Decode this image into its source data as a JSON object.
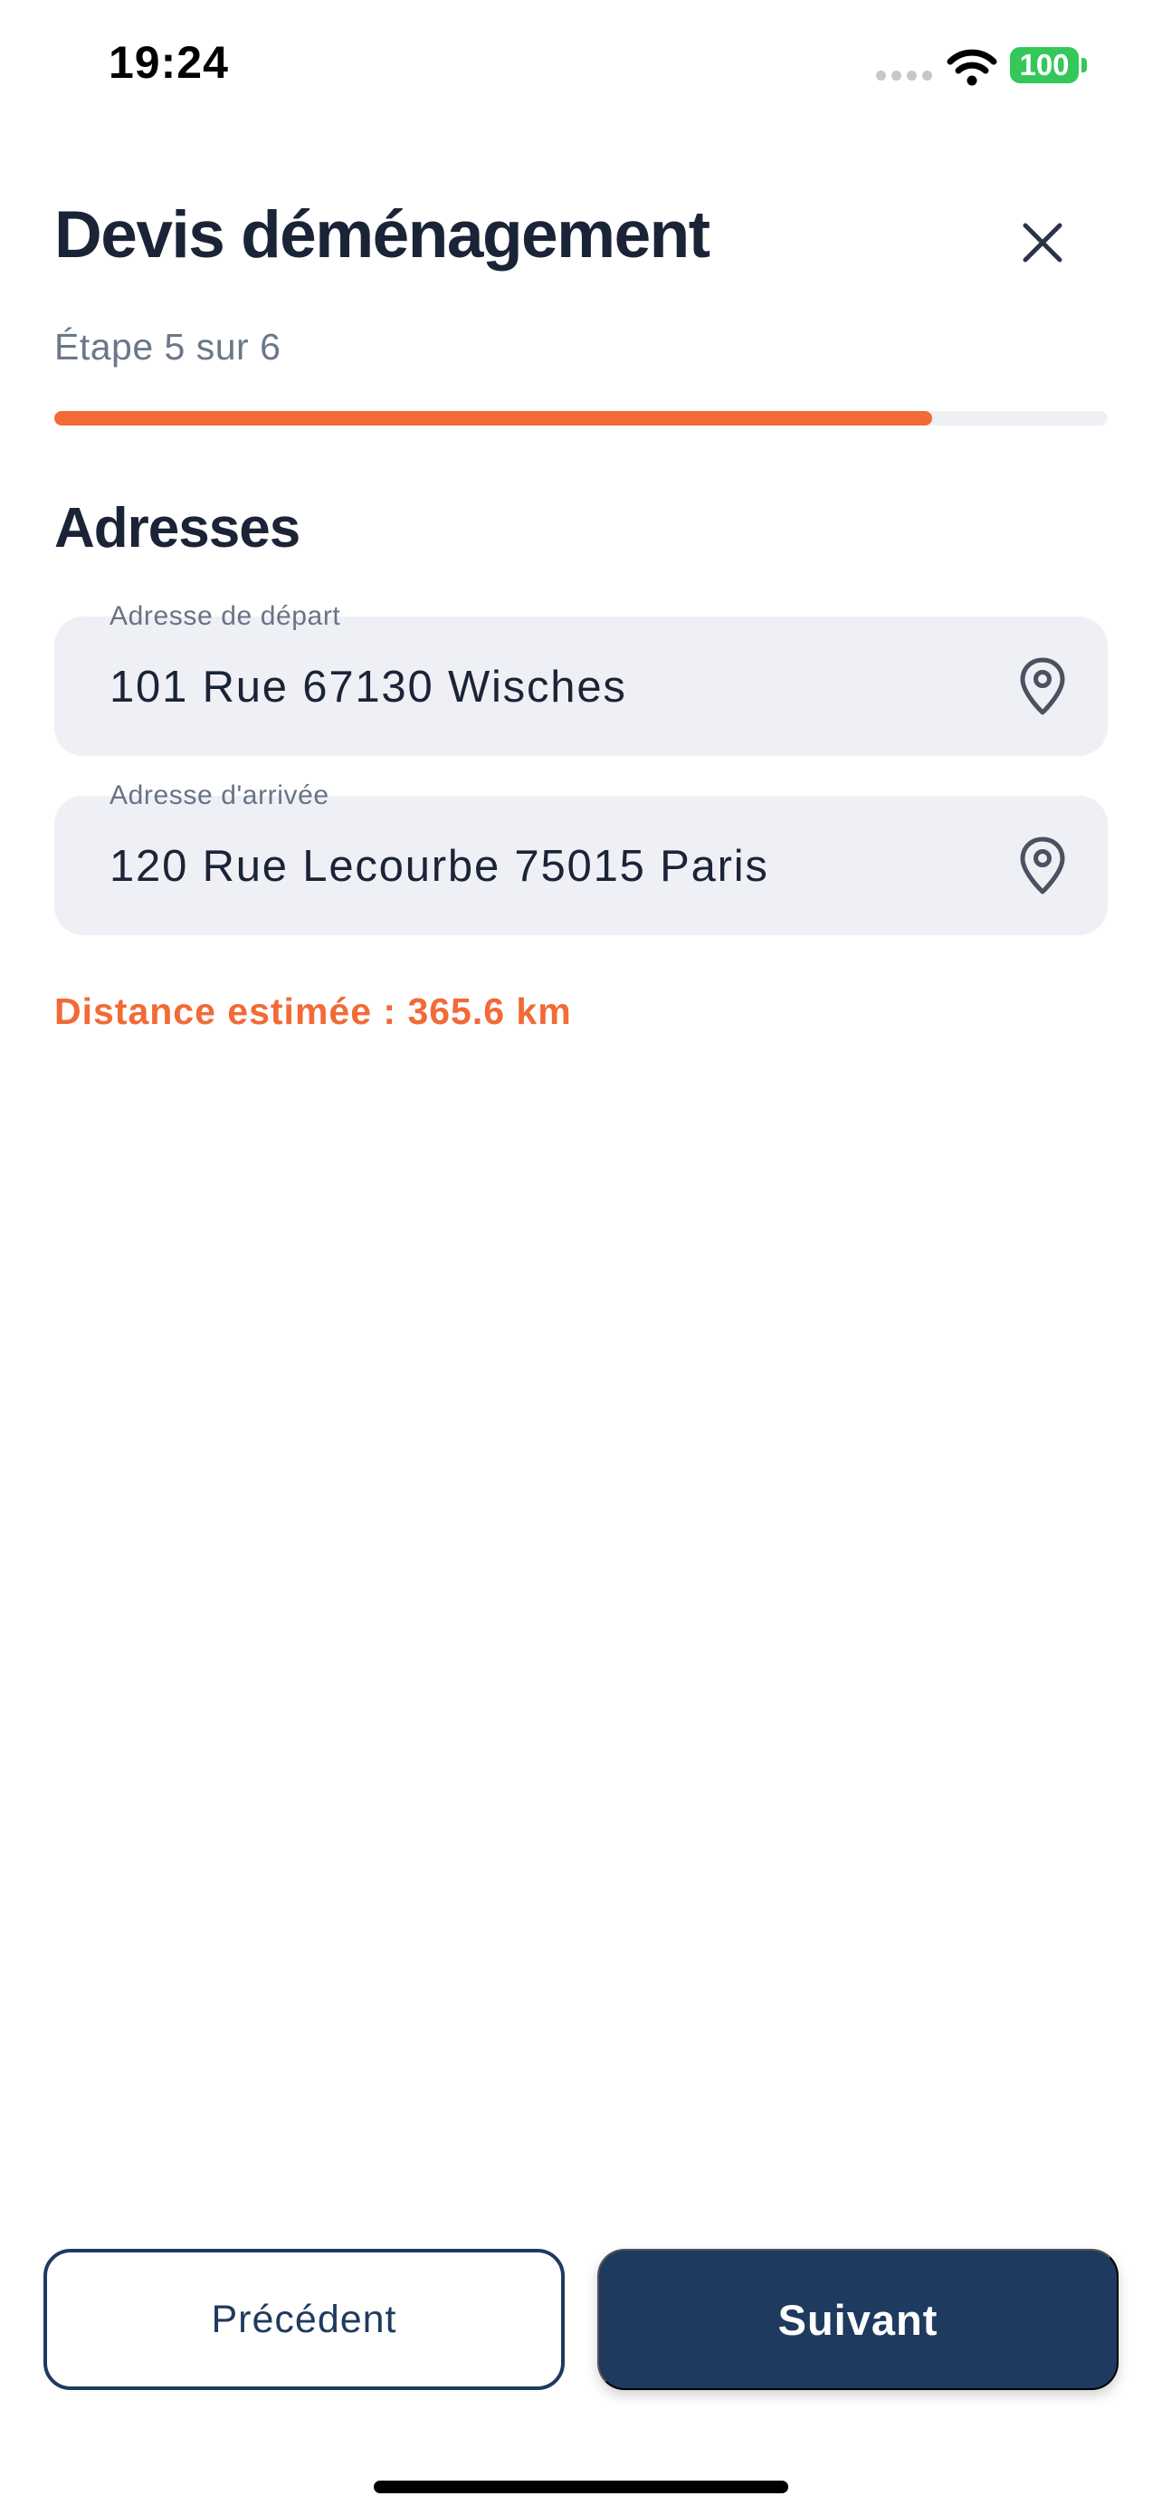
{
  "status_bar": {
    "time": "19:24",
    "battery": "100"
  },
  "header": {
    "title": "Devis déménagement",
    "close_icon": "close-icon",
    "step_label": "Étape 5 sur 6",
    "progress_fraction": 0.833
  },
  "section": {
    "title": "Adresses"
  },
  "fields": {
    "departure": {
      "label": "Adresse de départ",
      "value": "101 Rue 67130 Wisches",
      "icon": "map-pin-icon"
    },
    "arrival": {
      "label": "Adresse d'arrivée",
      "value": "120 Rue Lecourbe 75015 Paris",
      "icon": "map-pin-icon"
    }
  },
  "distance": "Distance estimée : 365.6 km",
  "footer": {
    "prev_label": "Précédent",
    "next_label": "Suivant"
  },
  "colors": {
    "accent": "#f26a35",
    "primary": "#1f3a5f",
    "field_bg": "#eef0f5",
    "battery": "#34c759"
  }
}
